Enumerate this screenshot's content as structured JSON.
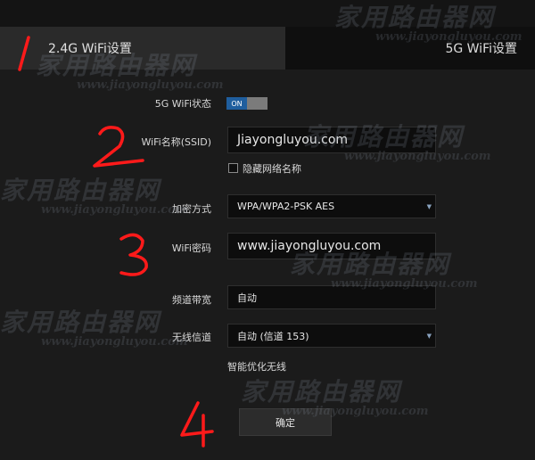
{
  "tabs": [
    {
      "label": "2.4G WiFi设置",
      "active": true
    },
    {
      "label": "5G WiFi设置",
      "active": false
    }
  ],
  "form": {
    "wifi_status_label": "5G WiFi状态",
    "toggle_on_label": "ON",
    "ssid_label": "WiFi名称(SSID)",
    "ssid_value": "Jiayongluyou.com",
    "hide_ssid_label": "隐藏网络名称",
    "hide_ssid_checked": false,
    "encryption_label": "加密方式",
    "encryption_value": "WPA/WPA2-PSK AES",
    "password_label": "WiFi密码",
    "password_value": "www.jiayongluyou.com",
    "bandwidth_label": "频道带宽",
    "bandwidth_value": "自动",
    "channel_label": "无线信道",
    "channel_value": "自动 (信道 153)",
    "smart_optimize_label": "智能优化无线",
    "confirm_label": "确定"
  },
  "annotations": [
    "1",
    "2",
    "3",
    "4"
  ],
  "watermark": {
    "text_cn": "家用路由器网",
    "text_en": "www.jiayongluyou.com"
  },
  "colors": {
    "toggle_on": "#1f5e9e",
    "annotation_red": "#ff1a1a",
    "background": "#1b1b1b"
  }
}
